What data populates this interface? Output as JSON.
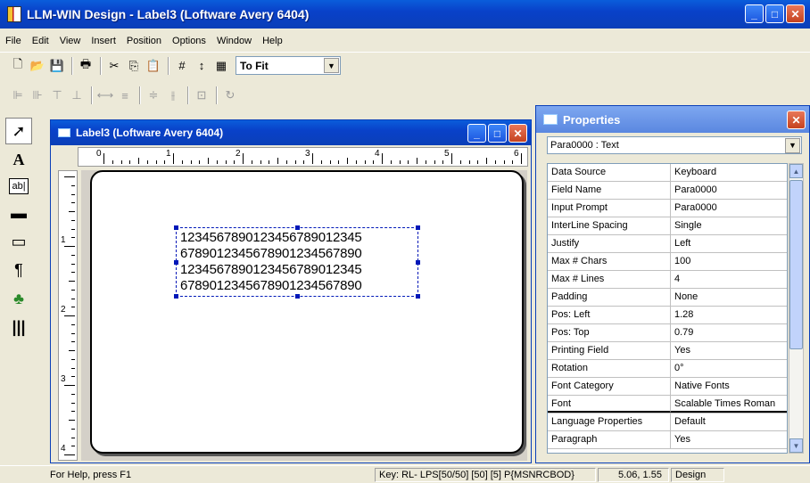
{
  "window": {
    "title": "LLM-WIN Design - Label3 (Loftware Avery 6404)"
  },
  "menu": [
    "File",
    "Edit",
    "View",
    "Insert",
    "Position",
    "Options",
    "Window",
    "Help"
  ],
  "toolbar": {
    "zoom_value": "To Fit"
  },
  "child": {
    "title": "Label3 (Loftware Avery 6404)"
  },
  "ruler": {
    "h_numbers": [
      "0",
      "1",
      "2",
      "3",
      "4",
      "5",
      "6"
    ],
    "v_numbers": [
      "1",
      "2",
      "3",
      "4"
    ]
  },
  "field": {
    "lines": [
      "12345678901234567890123​45",
      "678901234567890123​4567890",
      "12345678901234567890123​45",
      "678901234567890123​4567890"
    ]
  },
  "properties": {
    "title": "Properties",
    "selected_object": "Para0000 : Text",
    "rows": [
      {
        "k": "Data Source",
        "v": "Keyboard"
      },
      {
        "k": "Field Name",
        "v": "Para0000"
      },
      {
        "k": "Input Prompt",
        "v": "Para0000"
      },
      {
        "k": "InterLine Spacing",
        "v": "Single"
      },
      {
        "k": "Justify",
        "v": "Left"
      },
      {
        "k": "Max # Chars",
        "v": "100"
      },
      {
        "k": "Max # Lines",
        "v": "4"
      },
      {
        "k": "Padding",
        "v": "None"
      },
      {
        "k": "Pos: Left",
        "v": "1.28"
      },
      {
        "k": "Pos: Top",
        "v": "0.79"
      },
      {
        "k": "Printing Field",
        "v": "Yes"
      },
      {
        "k": "Rotation",
        "v": "0°"
      },
      {
        "k": "Font Category",
        "v": "Native Fonts"
      },
      {
        "k": "Font",
        "v": "Scalable Times Roman"
      },
      {
        "k": "Language Properties",
        "v": "Default"
      },
      {
        "k": "Paragraph",
        "v": "Yes"
      }
    ]
  },
  "status": {
    "help": "For Help, press F1",
    "key": "Key: RL- LPS[50/50] [50] [5] P{MSNRCBOD}",
    "coords": "5.06, 1.55",
    "mode": "Design"
  }
}
